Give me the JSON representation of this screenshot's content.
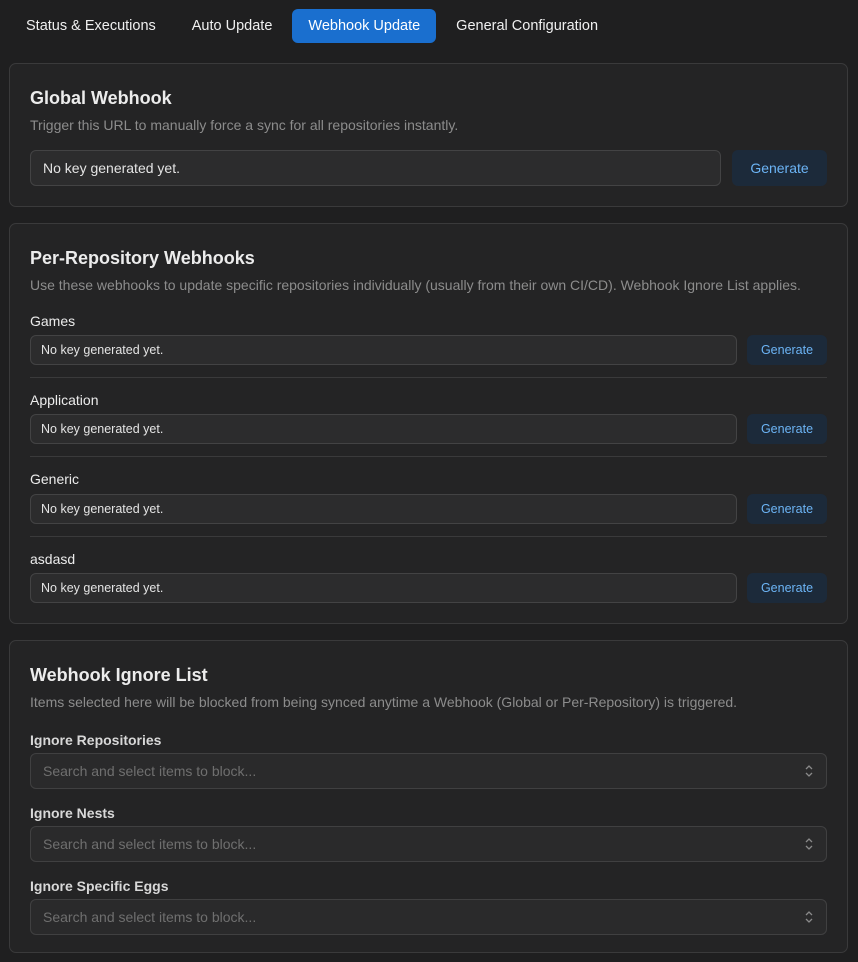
{
  "tabs": [
    {
      "label": "Status & Executions"
    },
    {
      "label": "Auto Update"
    },
    {
      "label": "Webhook Update"
    },
    {
      "label": "General Configuration"
    }
  ],
  "global": {
    "title": "Global Webhook",
    "description": "Trigger this URL to manually force a sync for all repositories instantly.",
    "value": "No key generated yet.",
    "button": "Generate"
  },
  "per_repo": {
    "title": "Per-Repository Webhooks",
    "description": "Use these webhooks to update specific repositories individually (usually from their own CI/CD). Webhook Ignore List applies.",
    "repos": [
      {
        "name": "Games",
        "value": "No key generated yet.",
        "button": "Generate"
      },
      {
        "name": "Application",
        "value": "No key generated yet.",
        "button": "Generate"
      },
      {
        "name": "Generic",
        "value": "No key generated yet.",
        "button": "Generate"
      },
      {
        "name": "asdasd",
        "value": "No key generated yet.",
        "button": "Generate"
      }
    ]
  },
  "ignore": {
    "title": "Webhook Ignore List",
    "description": "Items selected here will be blocked from being synced anytime a Webhook (Global or Per-Repository) is triggered.",
    "selects": [
      {
        "label": "Ignore Repositories",
        "placeholder": "Search and select items to block..."
      },
      {
        "label": "Ignore Nests",
        "placeholder": "Search and select items to block..."
      },
      {
        "label": "Ignore Specific Eggs",
        "placeholder": "Search and select items to block..."
      }
    ]
  }
}
